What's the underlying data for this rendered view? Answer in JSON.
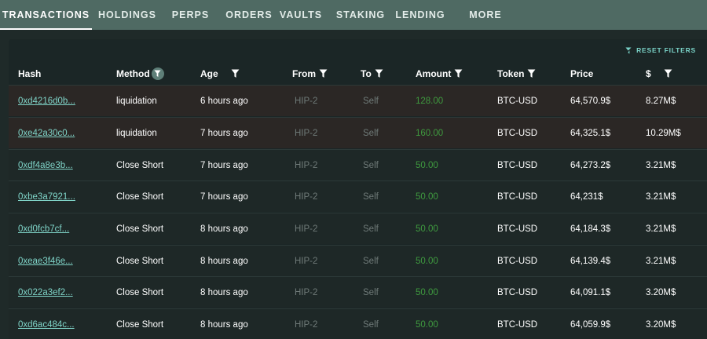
{
  "nav": {
    "tabs": [
      "TRANSACTIONS",
      "HOLDINGS",
      "PERPS",
      "ORDERS",
      "VAULTS",
      "STAKING",
      "LENDING",
      "MORE"
    ],
    "active": "TRANSACTIONS"
  },
  "toolbar": {
    "reset_label": "RESET FILTERS"
  },
  "table": {
    "columns": {
      "hash": "Hash",
      "method": "Method",
      "age": "Age",
      "from": "From",
      "to": "To",
      "amount": "Amount",
      "token": "Token",
      "price": "Price",
      "usd": "$"
    },
    "rows": [
      {
        "hash": "0xd4216d0b...",
        "method": "liquidation",
        "age": "6 hours ago",
        "from": "HIP-2",
        "to": "Self",
        "amount": "128.00",
        "token": "BTC-USD",
        "price": "64,570.9$",
        "usd": "8.27M$"
      },
      {
        "hash": "0xe42a30c0...",
        "method": "liquidation",
        "age": "7 hours ago",
        "from": "HIP-2",
        "to": "Self",
        "amount": "160.00",
        "token": "BTC-USD",
        "price": "64,325.1$",
        "usd": "10.29M$"
      },
      {
        "hash": "0xdf4a8e3b...",
        "method": "Close Short",
        "age": "7 hours ago",
        "from": "HIP-2",
        "to": "Self",
        "amount": "50.00",
        "token": "BTC-USD",
        "price": "64,273.2$",
        "usd": "3.21M$"
      },
      {
        "hash": "0xbe3a7921...",
        "method": "Close Short",
        "age": "7 hours ago",
        "from": "HIP-2",
        "to": "Self",
        "amount": "50.00",
        "token": "BTC-USD",
        "price": "64,231$",
        "usd": "3.21M$"
      },
      {
        "hash": "0xd0fcb7cf...",
        "method": "Close Short",
        "age": "8 hours ago",
        "from": "HIP-2",
        "to": "Self",
        "amount": "50.00",
        "token": "BTC-USD",
        "price": "64,184.3$",
        "usd": "3.21M$"
      },
      {
        "hash": "0xeae3f46e...",
        "method": "Close Short",
        "age": "8 hours ago",
        "from": "HIP-2",
        "to": "Self",
        "amount": "50.00",
        "token": "BTC-USD",
        "price": "64,139.4$",
        "usd": "3.21M$"
      },
      {
        "hash": "0x022a3ef2...",
        "method": "Close Short",
        "age": "8 hours ago",
        "from": "HIP-2",
        "to": "Self",
        "amount": "50.00",
        "token": "BTC-USD",
        "price": "64,091.1$",
        "usd": "3.20M$"
      },
      {
        "hash": "0xd6ac484c...",
        "method": "Close Short",
        "age": "8 hours ago",
        "from": "HIP-2",
        "to": "Self",
        "amount": "50.00",
        "token": "BTC-USD",
        "price": "64,059.9$",
        "usd": "3.20M$"
      }
    ]
  },
  "colors": {
    "nav_bg": "#4f6a63",
    "page_bg": "#1f2a29",
    "hash_link": "#7fd4c8",
    "amount_green": "#3f9a3f",
    "liquidation_row_bg": "#2b2725"
  },
  "icons": {
    "filter": "filter-icon",
    "reset": "filter-off-icon"
  }
}
